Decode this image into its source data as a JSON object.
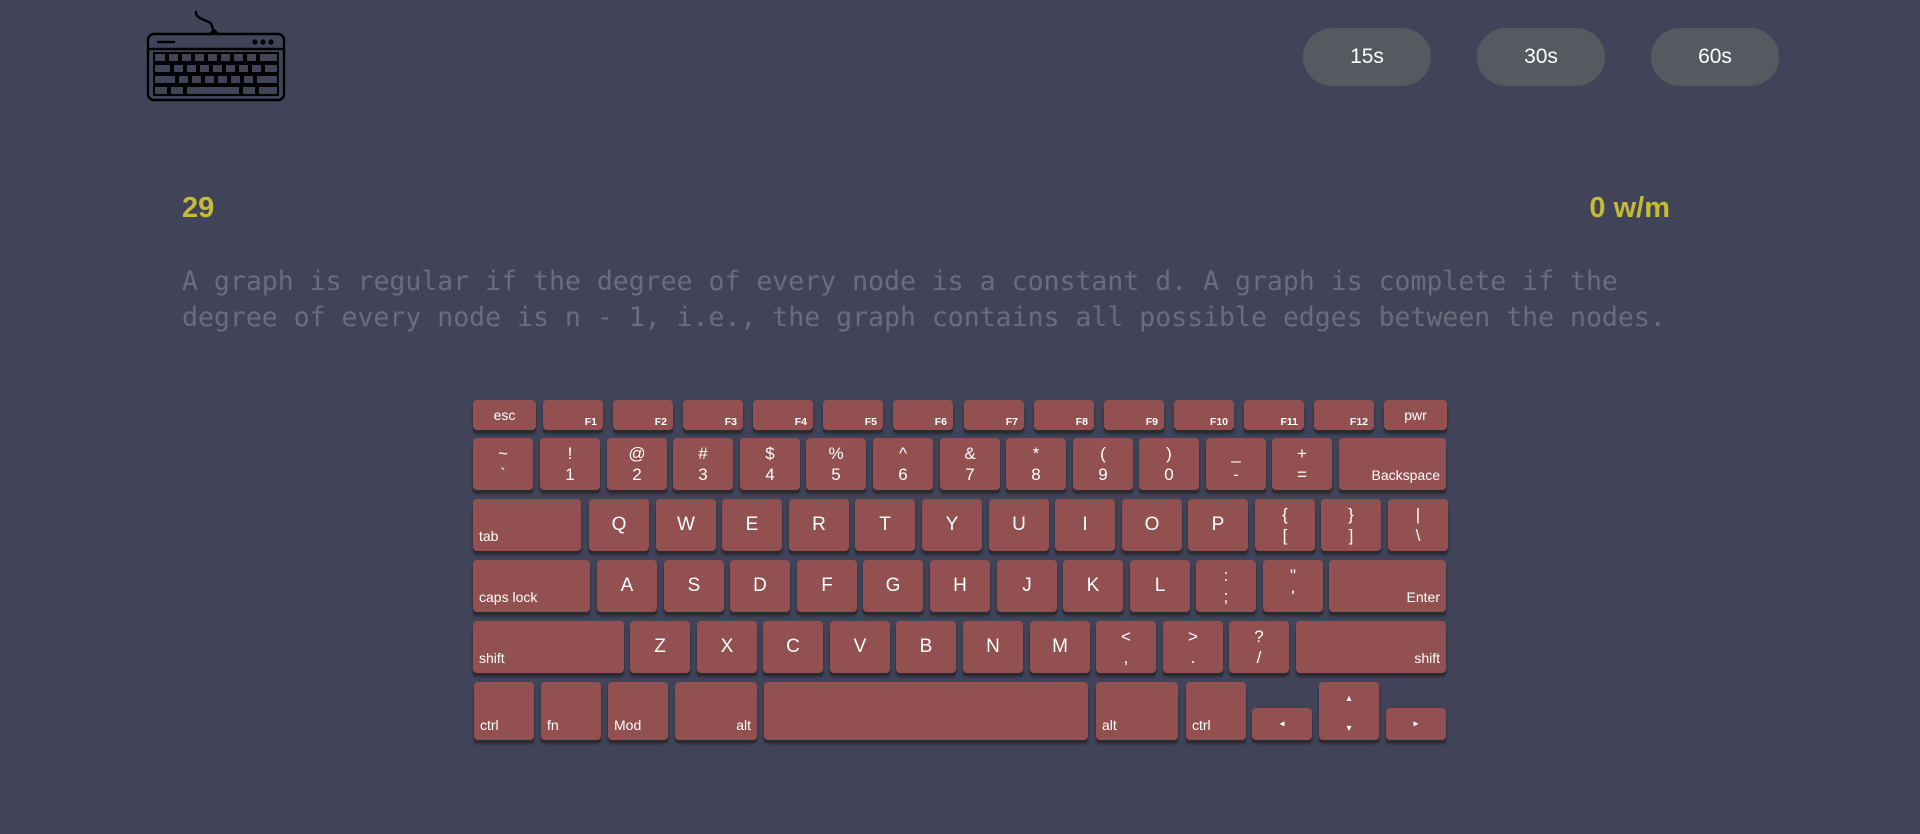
{
  "header": {
    "logo_icon": "keyboard-icon",
    "time_options": [
      "15s",
      "30s",
      "60s"
    ]
  },
  "stats": {
    "timer": "29",
    "wpm": "0 w/m"
  },
  "prompt": {
    "text": "A graph is regular if the degree of every node is a constant d. A graph is complete if the\ndegree of every node is n - 1, i.e., the graph contains all possible edges between the nodes."
  },
  "keyboard": {
    "row_function": [
      "esc",
      "F1",
      "F2",
      "F3",
      "F4",
      "F5",
      "F6",
      "F7",
      "F8",
      "F9",
      "F10",
      "F11",
      "F12",
      "pwr"
    ],
    "row_number": [
      {
        "top": "~",
        "bottom": "`"
      },
      {
        "top": "!",
        "bottom": "1"
      },
      {
        "top": "@",
        "bottom": "2"
      },
      {
        "top": "#",
        "bottom": "3"
      },
      {
        "top": "$",
        "bottom": "4"
      },
      {
        "top": "%",
        "bottom": "5"
      },
      {
        "top": "^",
        "bottom": "6"
      },
      {
        "top": "&",
        "bottom": "7"
      },
      {
        "top": "*",
        "bottom": "8"
      },
      {
        "top": "(",
        "bottom": "9"
      },
      {
        "top": ")",
        "bottom": "0"
      },
      {
        "top": "_",
        "bottom": "-"
      },
      {
        "top": "+",
        "bottom": "="
      },
      {
        "label": "Backspace"
      }
    ],
    "row_top": [
      {
        "label": "tab"
      },
      {
        "label": "Q"
      },
      {
        "label": "W"
      },
      {
        "label": "E"
      },
      {
        "label": "R"
      },
      {
        "label": "T"
      },
      {
        "label": "Y"
      },
      {
        "label": "U"
      },
      {
        "label": "I"
      },
      {
        "label": "O"
      },
      {
        "label": "P"
      },
      {
        "top": "{",
        "bottom": "["
      },
      {
        "top": "}",
        "bottom": "]"
      },
      {
        "top": "|",
        "bottom": "\\"
      }
    ],
    "row_home": [
      {
        "label": "caps lock"
      },
      {
        "label": "A"
      },
      {
        "label": "S"
      },
      {
        "label": "D"
      },
      {
        "label": "F"
      },
      {
        "label": "G"
      },
      {
        "label": "H"
      },
      {
        "label": "J"
      },
      {
        "label": "K"
      },
      {
        "label": "L"
      },
      {
        "top": ":",
        "bottom": ";"
      },
      {
        "top": "\"",
        "bottom": "'"
      },
      {
        "label": "Enter"
      }
    ],
    "row_bottom": [
      {
        "label": "shift"
      },
      {
        "label": "Z"
      },
      {
        "label": "X"
      },
      {
        "label": "C"
      },
      {
        "label": "V"
      },
      {
        "label": "B"
      },
      {
        "label": "N"
      },
      {
        "label": "M"
      },
      {
        "top": "<",
        "bottom": ","
      },
      {
        "top": ">",
        "bottom": "."
      },
      {
        "top": "?",
        "bottom": "/"
      },
      {
        "label": "shift"
      }
    ],
    "row_modifiers": [
      {
        "label": "ctrl"
      },
      {
        "label": "fn"
      },
      {
        "label": "Mod"
      },
      {
        "label": "alt"
      },
      {
        "label": ""
      },
      {
        "label": "alt"
      },
      {
        "label": "ctrl"
      }
    ],
    "arrows": {
      "left": "◂",
      "up": "▴",
      "down": "▾",
      "right": "▸"
    }
  },
  "colors": {
    "background": "#414459",
    "key": "#935050",
    "accent": "#c6bb35",
    "prompt_text": "#6a6d7c",
    "time_button": "#545a5f"
  }
}
